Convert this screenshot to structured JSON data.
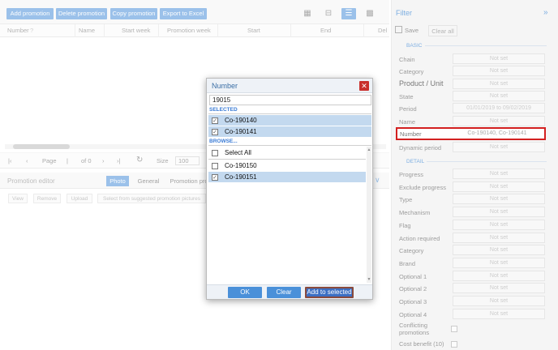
{
  "toolbar": {
    "add_promotion": "Add promotion",
    "delete_promotion": "Delete promotion",
    "copy_promotion": "Copy promotion",
    "export_excel": "Export to Excel"
  },
  "grid": {
    "columns": [
      "Number",
      "Name",
      "Start week",
      "Promotion week",
      "Start",
      "End",
      "Del"
    ]
  },
  "pager": {
    "page_label": "Page",
    "of_label": "of 0",
    "size_label": "Size",
    "size_value": "100"
  },
  "editor": {
    "title": "Promotion editor",
    "tabs": [
      "Photo",
      "General",
      "Promotion pro"
    ],
    "buttons": [
      "View",
      "Remove",
      "Upload",
      "Select from suggested promotion pictures"
    ]
  },
  "filter": {
    "title": "Filter",
    "save": "Save",
    "clear_all": "Clear all",
    "basic_section": "BASIC",
    "detail_section": "DETAIL",
    "placeholder": "Not set",
    "basic_rows": [
      {
        "label": "Chain",
        "value": "Not set"
      },
      {
        "label": "Category",
        "value": "Not set"
      },
      {
        "label": "Product / Unit",
        "value": "Not set"
      },
      {
        "label": "State",
        "value": "Not set"
      },
      {
        "label": "Period",
        "value": "01/01/2019 to 09/02/2019"
      },
      {
        "label": "Name",
        "value": "Not set"
      }
    ],
    "number_row": {
      "label": "Number",
      "value": "Co-190140, Co-190141"
    },
    "dynamic_period": {
      "label": "Dynamic period",
      "value": "Not set"
    },
    "detail_rows": [
      {
        "label": "Progress",
        "value": "Not set"
      },
      {
        "label": "Exclude progress",
        "value": "Not set"
      },
      {
        "label": "Type",
        "value": "Not set"
      },
      {
        "label": "Mechanism",
        "value": "Not set"
      },
      {
        "label": "Flag",
        "value": "Not set"
      },
      {
        "label": "Action required",
        "value": "Not set"
      },
      {
        "label": "Category",
        "value": "Not set"
      },
      {
        "label": "Brand",
        "value": "Not set"
      },
      {
        "label": "Optional 1",
        "value": "Not set"
      },
      {
        "label": "Optional 2",
        "value": "Not set"
      },
      {
        "label": "Optional 3",
        "value": "Not set"
      },
      {
        "label": "Optional 4",
        "value": "Not set"
      }
    ],
    "conflicting": "Conflicting promotions",
    "cost_benefit": "Cost benefit (10)"
  },
  "dialog": {
    "title": "Number",
    "search_value": "19015",
    "selected_label": "SELECTED",
    "selected": [
      "Co-190140",
      "Co-190141"
    ],
    "browse_label": "BROWSE...",
    "select_all": "Select All",
    "browse": [
      {
        "label": "Co-190150",
        "checked": false
      },
      {
        "label": "Co-190151",
        "checked": true
      }
    ],
    "ok": "OK",
    "clear": "Clear",
    "add_to_selected": "Add to selected"
  }
}
